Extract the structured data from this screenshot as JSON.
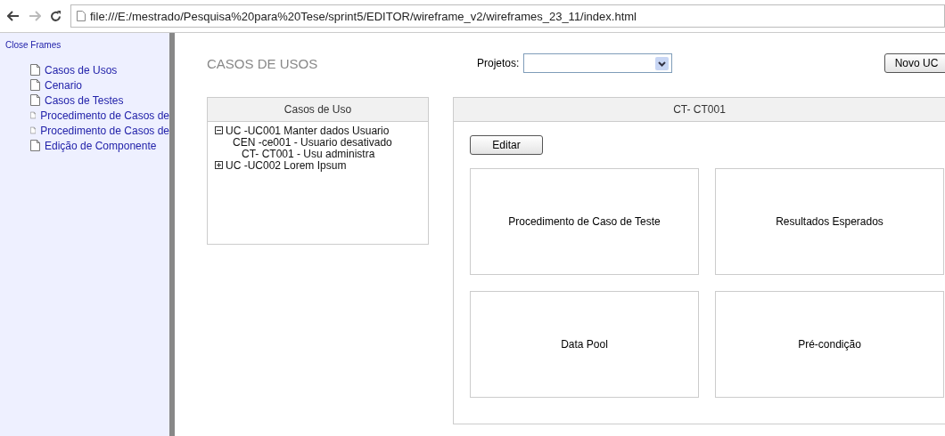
{
  "browser": {
    "url": "file:///E:/mestrado/Pesquisa%20para%20Tese/sprint5/EDITOR/wireframe_v2/wireframes_23_11/index.html"
  },
  "sidebar": {
    "close_link": "Close Frames",
    "items": [
      {
        "label": "Casos de Usos"
      },
      {
        "label": "Cenario"
      },
      {
        "label": "Casos de Testes"
      },
      {
        "label": "Procedimento de Casos de"
      },
      {
        "label": "Procedimento de Casos de"
      },
      {
        "label": "Edição de Componente"
      }
    ]
  },
  "page_title": "CASOS DE USOS",
  "projects": {
    "label": "Projetos:"
  },
  "new_button": "Novo UC",
  "tree_panel": {
    "title": "Casos de Uso",
    "items": [
      {
        "label": "UC -UC001  Manter dados Usuario",
        "expanded": true,
        "children": [
          {
            "label": "CEN -ce001 - Usuario desativado",
            "children": [
              {
                "label": "CT- CT001 - Usu administra"
              }
            ]
          }
        ]
      },
      {
        "label": "UC -UC002  Lorem Ipsum",
        "expanded": false
      }
    ]
  },
  "detail_panel": {
    "title": "CT- CT001",
    "edit_button": "Editar",
    "cards": [
      "Procedimento de Caso de Teste",
      "Resultados Esperados",
      "Data Pool",
      "Pré-condição"
    ]
  }
}
